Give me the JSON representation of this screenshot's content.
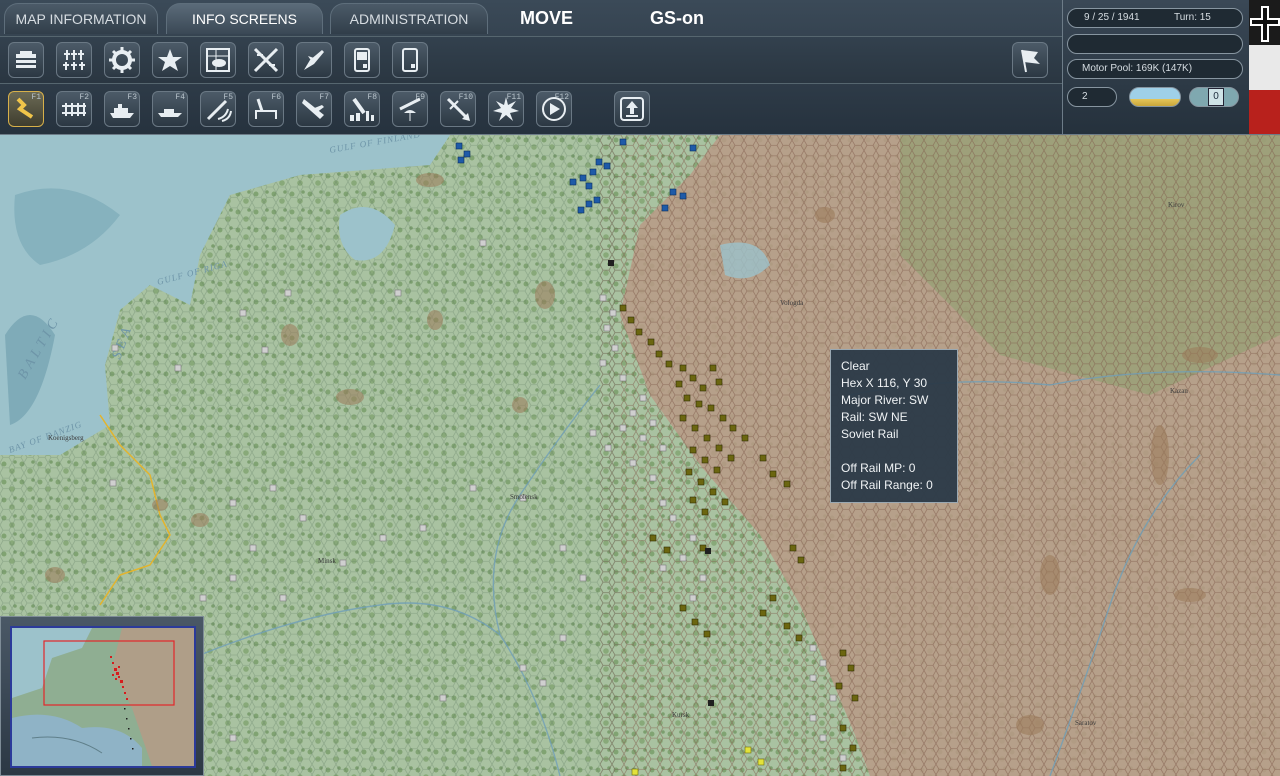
{
  "tabs": [
    {
      "label": "MAP INFORMATION",
      "active": false
    },
    {
      "label": "INFO SCREENS",
      "active": true
    },
    {
      "label": "ADMINISTRATION",
      "active": false
    }
  ],
  "mode_label": "MOVE",
  "gs_label": "GS-on",
  "toolbar_row1": [
    {
      "name": "unit-list-icon"
    },
    {
      "name": "commanders-icon"
    },
    {
      "name": "production-gear-icon"
    },
    {
      "name": "victory-star-icon"
    },
    {
      "name": "weather-icon"
    },
    {
      "name": "air-combat-icon"
    },
    {
      "name": "air-missions-icon"
    },
    {
      "name": "supply-depot-icon"
    },
    {
      "name": "reports-icon"
    }
  ],
  "toolbar_row1_right": {
    "name": "surrender-flag-icon"
  },
  "toolbar_row2": [
    {
      "name": "move-mode-icon",
      "fkey": "F1",
      "selected": true
    },
    {
      "name": "rail-mode-icon",
      "fkey": "F2"
    },
    {
      "name": "naval-transport-icon",
      "fkey": "F3"
    },
    {
      "name": "naval-mode-icon",
      "fkey": "F4"
    },
    {
      "name": "air-recon-icon",
      "fkey": "F5"
    },
    {
      "name": "construction-icon",
      "fkey": "F6"
    },
    {
      "name": "air-transfer-icon",
      "fkey": "F7"
    },
    {
      "name": "city-bombing-icon",
      "fkey": "F8"
    },
    {
      "name": "airborne-drop-icon",
      "fkey": "F9"
    },
    {
      "name": "air-attack-icon",
      "fkey": "F10"
    },
    {
      "name": "explosion-icon",
      "fkey": "F11"
    },
    {
      "name": "next-unit-icon",
      "fkey": "F12"
    }
  ],
  "upload_button": {
    "name": "upload-icon"
  },
  "status": {
    "date": "9 / 25 / 1941",
    "turn": "Turn: 15",
    "blank": "",
    "motor_pool": "Motor Pool:  169K (147K)",
    "counter": "2",
    "pill_value": "0"
  },
  "tooltip": {
    "lines": [
      "Clear",
      "Hex X 116, Y 30",
      "Major River: SW",
      "Rail: SW NE",
      "Soviet Rail",
      "",
      "Off Rail MP: 0",
      "Off Rail Range: 0"
    ]
  },
  "map_labels": [
    {
      "text": "BALTIC",
      "kind": "sea"
    },
    {
      "text": "SEA",
      "kind": "sea"
    },
    {
      "text": "GULF OF RIGA",
      "kind": "sea"
    },
    {
      "text": "GULF OF FINLAND",
      "kind": "sea"
    },
    {
      "text": "BAY OF DANZIG",
      "kind": "sea"
    },
    {
      "text": "Minsk",
      "kind": "city"
    },
    {
      "text": "Kursk",
      "kind": "city"
    },
    {
      "text": "Koenigsberg",
      "kind": "city"
    },
    {
      "text": "Smolensk",
      "kind": "city"
    },
    {
      "text": "Kazan",
      "kind": "city"
    },
    {
      "text": "Saratov",
      "kind": "city"
    },
    {
      "text": "Kirov",
      "kind": "city"
    },
    {
      "text": "Vologda",
      "kind": "city"
    }
  ],
  "colors": {
    "sea": "#9ec3cc",
    "land": "#a7bf9e",
    "soviet_land": "#b79a84",
    "axis_unit": "#6b6610",
    "soviet_unit": "#c9c9c9",
    "finnish_unit": "#1e5aa8",
    "frontline": "#e3b42c"
  }
}
